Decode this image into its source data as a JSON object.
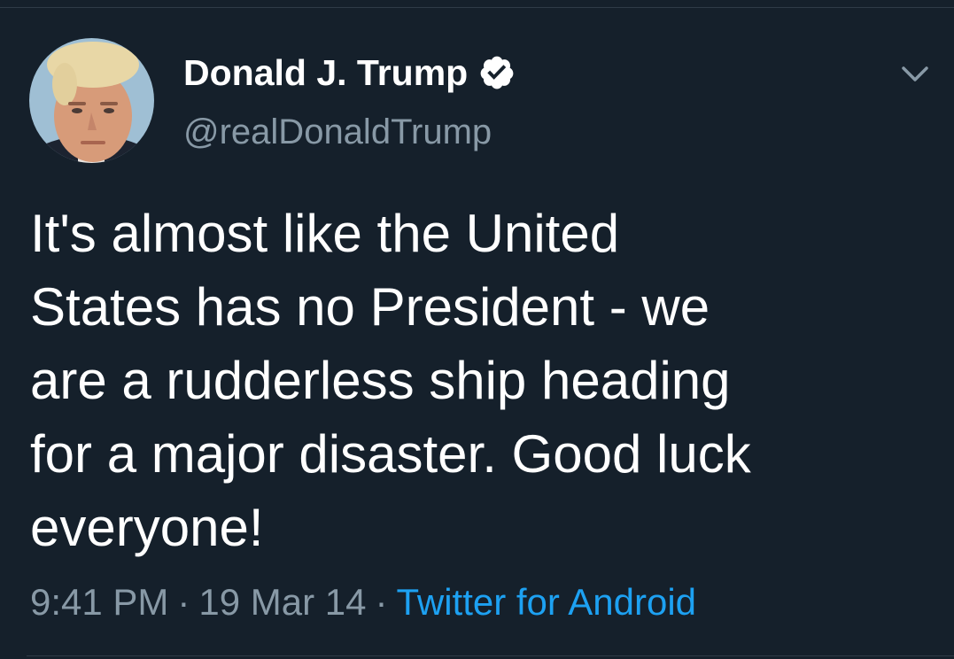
{
  "author": {
    "display_name": "Donald J. Trump",
    "handle": "@realDonaldTrump",
    "verified": true,
    "avatar": "profile-photo"
  },
  "tweet": {
    "lines": [
      "It's almost like the United",
      "States has no President - we",
      "are a rudderless ship heading",
      "for a major disaster. Good luck",
      "everyone!"
    ]
  },
  "meta": {
    "time": "9:41 PM",
    "separator": "·",
    "date": "19 Mar 14",
    "source": "Twitter for Android"
  },
  "icons": {
    "verified": "verified-badge-icon",
    "menu": "chevron-down-icon"
  },
  "colors": {
    "background": "#15202b",
    "text": "#ffffff",
    "secondary": "#8899a6",
    "link": "#1da1f2"
  }
}
